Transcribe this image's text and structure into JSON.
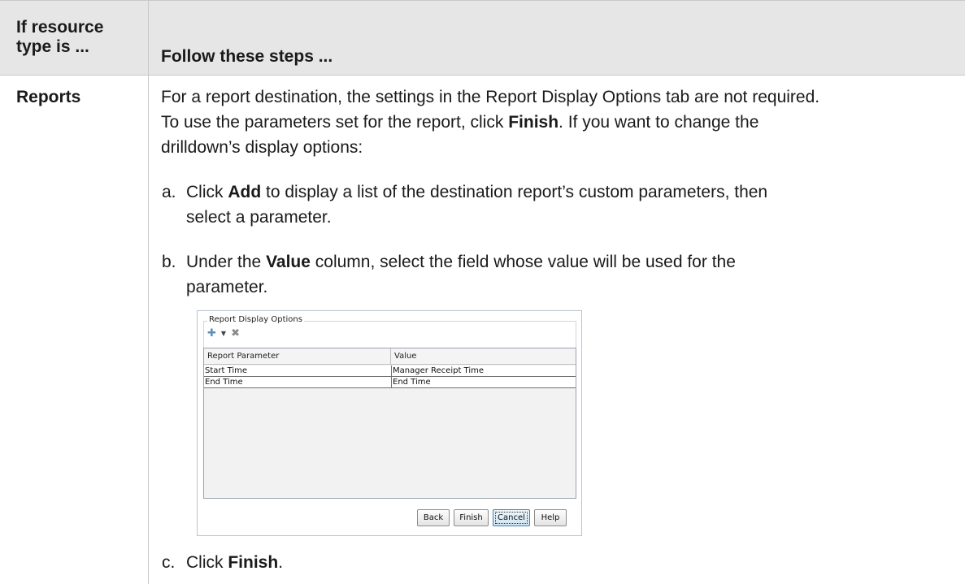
{
  "table": {
    "headers": {
      "col1": [
        "If resource",
        "type is ..."
      ],
      "col2": "Follow these steps ..."
    },
    "row": {
      "resource_type": "Reports",
      "intro": [
        "For a report destination, the settings in the Report Display Options tab are not required.",
        [
          "To use the parameters set for the report, click ",
          "Finish",
          ". If you want to change the"
        ],
        "drilldown’s display options:"
      ],
      "steps": [
        {
          "marker": "a.",
          "lines": [
            [
              "Click ",
              "Add",
              " to display a list of the destination report’s custom parameters, then"
            ],
            [
              "select a parameter."
            ]
          ]
        },
        {
          "marker": "b.",
          "lines": [
            [
              "Under the ",
              "Value",
              " column, select the field whose value will be used for the"
            ],
            [
              "parameter."
            ]
          ]
        },
        {
          "marker": "c.",
          "lines": [
            [
              "Click ",
              "Finish",
              "."
            ]
          ]
        }
      ]
    }
  },
  "dialog": {
    "group_title": "Report Display Options",
    "toolbar": {
      "add_icon": "add-plus-icon",
      "dropdown_icon": "dropdown-arrow-icon",
      "remove_icon": "remove-x-icon"
    },
    "columns": [
      "Report Parameter",
      "Value"
    ],
    "rows": [
      [
        "Start Time",
        "Manager Receipt Time"
      ],
      [
        "End Time",
        "End Time"
      ]
    ],
    "buttons": {
      "back": "Back",
      "finish": "Finish",
      "cancel": "Cancel",
      "help": "Help"
    }
  }
}
